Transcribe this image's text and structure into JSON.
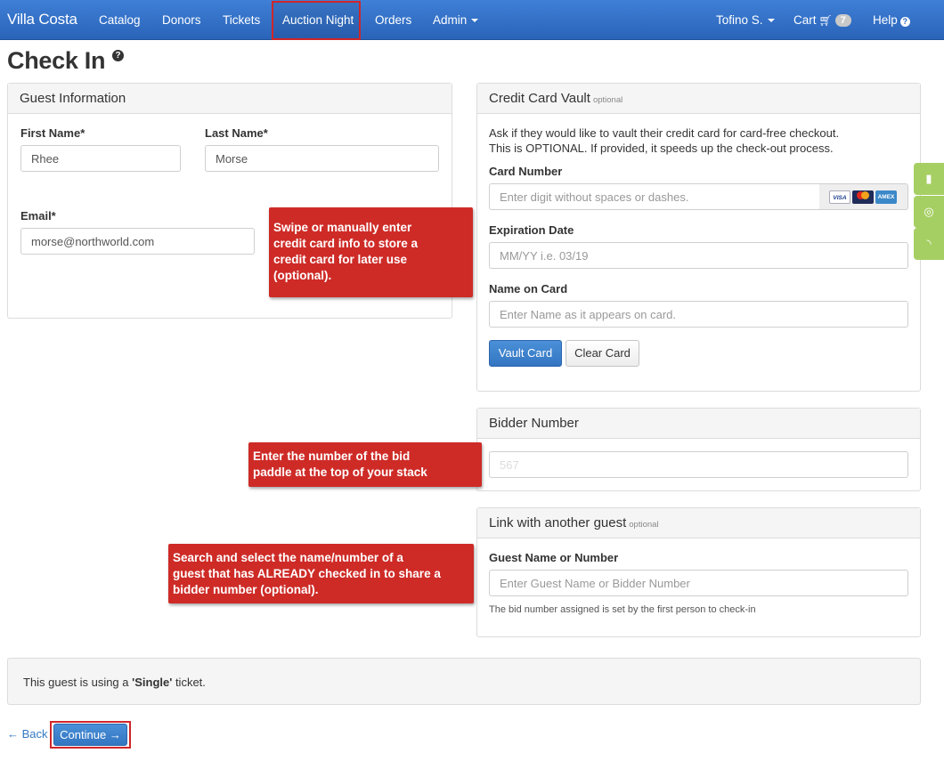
{
  "navbar": {
    "brand": "Villa Costa",
    "items": [
      "Catalog",
      "Donors",
      "Tickets",
      "Auction Night",
      "Orders",
      "Admin"
    ],
    "user": "Tofino S.",
    "cart_label": "Cart",
    "cart_count": "7",
    "help_label": "Help"
  },
  "page": {
    "title": "Check In"
  },
  "guest": {
    "heading": "Guest Information",
    "first_name_label": "First Name*",
    "first_name_value": "Rhee",
    "last_name_label": "Last Name*",
    "last_name_value": "Morse",
    "email_label": "Email*",
    "email_value": "morse@northworld.com"
  },
  "vault": {
    "heading": "Credit Card Vault",
    "optional": "optional",
    "desc_line1": "Ask if they would like to vault their credit card for card-free checkout.",
    "desc_line2": "This is OPTIONAL. If provided, it speeds up the check-out process.",
    "card_number_label": "Card Number",
    "card_number_placeholder": "Enter digit without spaces or dashes.",
    "card_logos": [
      "VISA",
      "MC",
      "AMEX"
    ],
    "expiration_label": "Expiration Date",
    "expiration_placeholder": "MM/YY i.e. 03/19",
    "name_label": "Name on Card",
    "name_placeholder": "Enter Name as it appears on card.",
    "vault_button": "Vault Card",
    "clear_button": "Clear Card"
  },
  "bidder": {
    "heading": "Bidder Number",
    "placeholder": "567"
  },
  "link": {
    "heading": "Link with another guest",
    "optional": "optional",
    "field_label": "Guest Name or Number",
    "placeholder": "Enter Guest Name or Bidder Number",
    "help": "The bid number assigned is set by the first person to check-in"
  },
  "callouts": {
    "swipe": [
      "Swipe or manually enter",
      "credit card info to store a",
      "credit card for later use",
      "(optional)."
    ],
    "paddle": [
      "Enter the number of the bid",
      "paddle at the top of your stack"
    ],
    "search": [
      "Search and select the name/number of a",
      "guest that has ALREADY checked in to share a",
      "bidder number (optional)."
    ]
  },
  "notice": {
    "prefix": "This guest is using a ",
    "ticket": "'Single'",
    "suffix": " ticket."
  },
  "footer": {
    "back": "← Back",
    "continue": "Continue →"
  },
  "colors": {
    "navbar": "#2a64b9",
    "callout": "#ce2b27",
    "highlight": "#d0262a",
    "primary_button": "#3375c1",
    "side_tab": "#a6cf63"
  }
}
